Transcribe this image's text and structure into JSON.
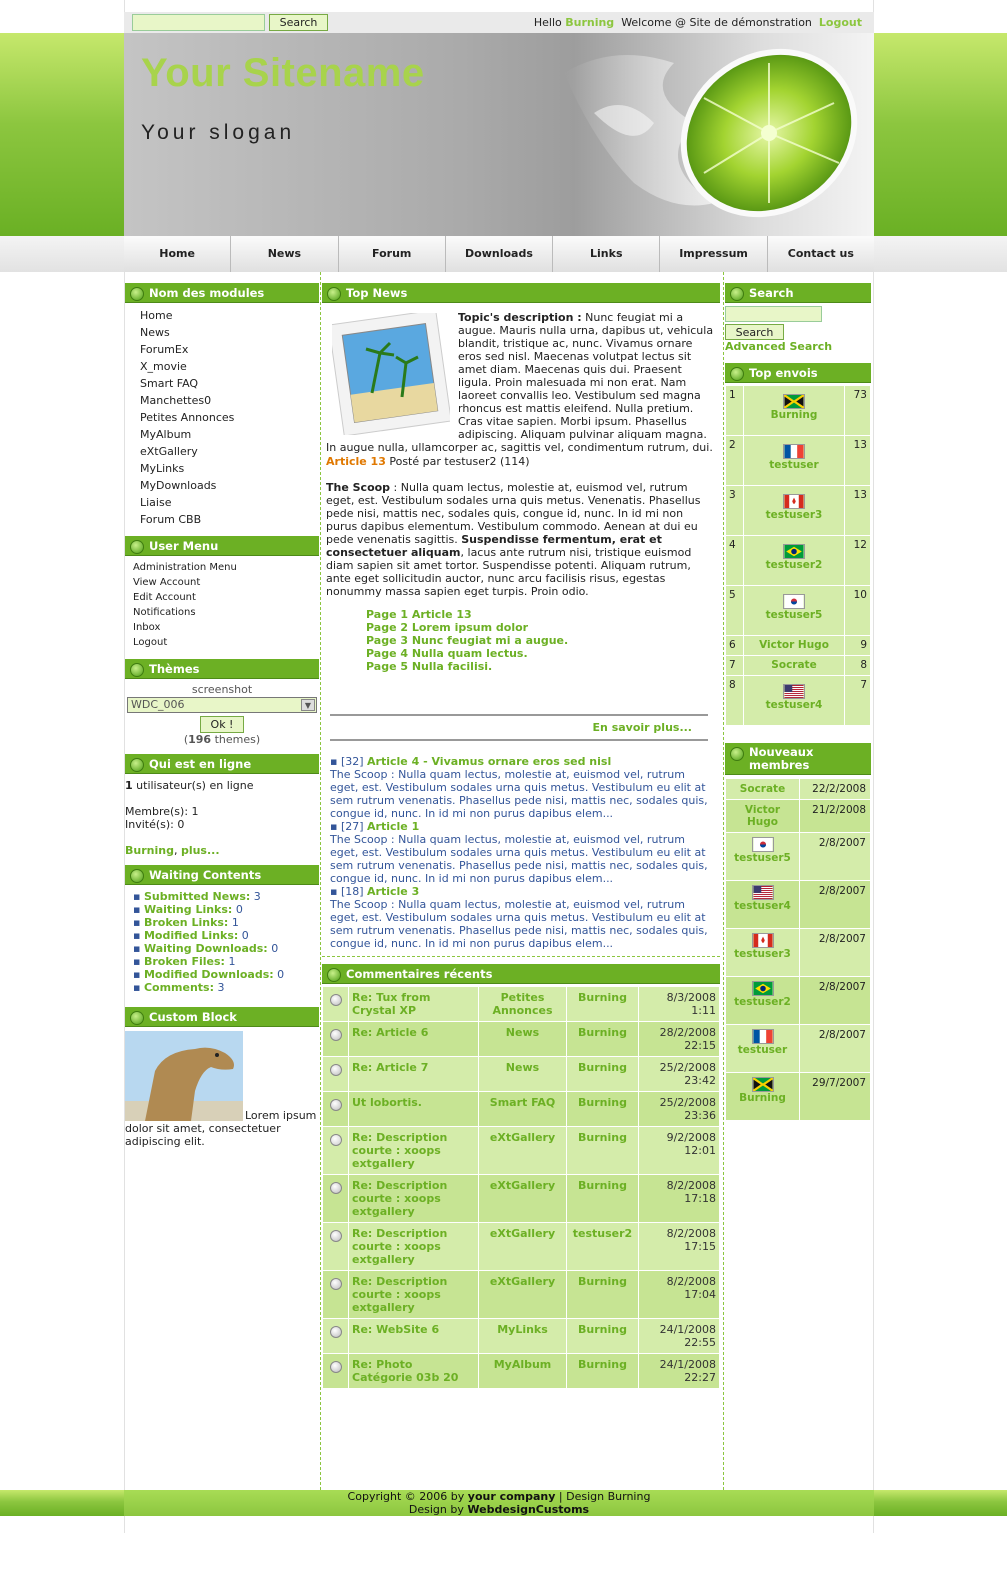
{
  "topbar": {
    "search_placeholder": "",
    "search_button": "Search",
    "hello": "Hello",
    "user": "Burning",
    "welcome": "Welcome @ Site de démonstration",
    "logout": "Logout"
  },
  "header": {
    "sitename": "Your Sitename",
    "slogan": "Your slogan"
  },
  "nav": [
    "Home",
    "News",
    "Forum",
    "Downloads",
    "Links",
    "Impressum",
    "Contact us"
  ],
  "modules": {
    "title": "Nom des modules",
    "items": [
      "Home",
      "News",
      "ForumEx",
      "X_movie",
      "Smart FAQ",
      "Manchettes0",
      "Petites Annonces",
      "MyAlbum",
      "eXtGallery",
      "MyLinks",
      "MyDownloads",
      "Liaise",
      "Forum CBB"
    ]
  },
  "usermenu": {
    "title": "User Menu",
    "items": [
      "Administration Menu",
      "View Account",
      "Edit Account",
      "Notifications",
      "Inbox",
      "Logout"
    ]
  },
  "themes": {
    "title": "Thèmes",
    "caption": "screenshot",
    "selected": "WDC_006",
    "ok": "Ok !",
    "count_pre": "(",
    "count": "196",
    "count_post": " themes)"
  },
  "online": {
    "title": "Qui est en ligne",
    "count": "1",
    "line1": " utilisateur(s) en ligne",
    "members": "Membre(s): 1",
    "guests": "Invité(s): 0",
    "user": "Burning",
    "more": "plus..."
  },
  "waiting": {
    "title": "Waiting Contents",
    "items": [
      {
        "label": "Submitted News:",
        "val": "3"
      },
      {
        "label": "Waiting Links:",
        "val": "0"
      },
      {
        "label": "Broken Links:",
        "val": "1"
      },
      {
        "label": "Modified Links:",
        "val": "0"
      },
      {
        "label": "Waiting Downloads:",
        "val": "0"
      },
      {
        "label": "Broken Files:",
        "val": "1"
      },
      {
        "label": "Modified Downloads:",
        "val": "0"
      },
      {
        "label": "Comments:",
        "val": "3"
      }
    ]
  },
  "custom": {
    "title": "Custom Block",
    "text": "Lorem ipsum dolor sit amet, consectetuer adipiscing elit."
  },
  "topnews": {
    "title": "Top News",
    "desc_label": "Topic's description :",
    "desc": " Nunc feugiat mi a augue. Mauris nulla urna, dapibus ut, vehicula blandit, tristique ac, nunc. Vivamus ornare eros sed nisl. Maecenas volutpat lectus sit amet diam. Maecenas quis dui. Praesent ligula. Proin malesuada mi non erat. Nam laoreet convallis leo. Vestibulum sed magna rhoncus est mattis eleifend. Nulla pretium. Cras vitae sapien. Morbi ipsum. Phasellus adipiscing. Aliquam pulvinar aliquam magna. In augue nulla, ullamcorper ac, sagittis vel, condimentum rutrum, dui.",
    "article": "Article 13",
    "posted": " Posté par testuser2 (114)",
    "scoop_label": "The Scoop",
    "scoop1": " : Nulla quam lectus, molestie at, euismod vel, rutrum eget, est. Vestibulum sodales urna quis metus. Venenatis. Phasellus pede nisi, mattis nec, sodales quis, congue id, nunc. In id mi non purus dapibus elementum. Vestibulum commodo. Aenean at dui eu pede venenatis sagittis. ",
    "scoop_bold": "Suspendisse fermentum, erat et consectetuer aliquam",
    "scoop2": ", lacus ante rutrum nisi, tristique euismod diam sapien sit amet tortor. Suspendisse potenti. Aliquam rutrum, ante eget sollicitudin auctor, nunc arcu facilisis risus, egestas nonummy massa sapien eget turpis. Proin odio.",
    "pages": [
      "Page 1 Article 13",
      "Page 2 Lorem ipsum dolor",
      "Page 3 Nunc feugiat mi a augue.",
      "Page 4 Nulla quam lectus.",
      "Page 5 Nulla facilisi."
    ],
    "more": "En savoir plus...",
    "list": [
      {
        "count": "[32]",
        "title": "Article 4 - Vivamus ornare eros sed nisl",
        "text": "The Scoop : Nulla quam lectus, molestie at, euismod vel, rutrum eget, est. Vestibulum sodales urna quis metus. Vestibulum eu elit at sem rutrum venenatis. Phasellus pede nisi, mattis nec, sodales quis, congue id, nunc. In id mi non purus dapibus elem..."
      },
      {
        "count": "[27]",
        "title": "Article 1",
        "text": "The Scoop : Nulla quam lectus, molestie at, euismod vel, rutrum eget, est. Vestibulum sodales urna quis metus. Vestibulum eu elit at sem rutrum venenatis. Phasellus pede nisi, mattis nec, sodales quis, congue id, nunc. In id mi non purus dapibus elem..."
      },
      {
        "count": "[18]",
        "title": "Article 3",
        "text": "The Scoop : Nulla quam lectus, molestie at, euismod vel, rutrum eget, est. Vestibulum sodales urna quis metus. Vestibulum eu elit at sem rutrum venenatis. Phasellus pede nisi, mattis nec, sodales quis, congue id, nunc. In id mi non purus dapibus elem..."
      }
    ]
  },
  "comments": {
    "title": "Commentaires récents",
    "rows": [
      {
        "title": "Re: Tux from Crystal XP",
        "module": "Petites Annonces",
        "user": "Burning",
        "date": "8/3/2008",
        "time": "1:11",
        "icon": "circle"
      },
      {
        "title": "Re: Article 6",
        "module": "News",
        "user": "Burning",
        "date": "28/2/2008",
        "time": "22:15",
        "icon": "circle"
      },
      {
        "title": "Re: Article 7",
        "module": "News",
        "user": "Burning",
        "date": "25/2/2008",
        "time": "23:42",
        "icon": "circle"
      },
      {
        "title": "Ut lobortis.",
        "module": "Smart FAQ",
        "user": "Burning",
        "date": "25/2/2008",
        "time": "23:36",
        "icon": "circle"
      },
      {
        "title": "Re: Description courte : xoops extgallery",
        "module": "eXtGallery",
        "user": "Burning",
        "date": "9/2/2008",
        "time": "12:01",
        "icon": "smiley"
      },
      {
        "title": "Re: Description courte : xoops extgallery",
        "module": "eXtGallery",
        "user": "Burning",
        "date": "8/2/2008",
        "time": "17:18",
        "icon": "circle"
      },
      {
        "title": "Re: Description courte : xoops extgallery",
        "module": "eXtGallery",
        "user": "testuser2",
        "date": "8/2/2008",
        "time": "17:15",
        "icon": "circle"
      },
      {
        "title": "Re: Description courte : xoops extgallery",
        "module": "eXtGallery",
        "user": "Burning",
        "date": "8/2/2008",
        "time": "17:04",
        "icon": "circle"
      },
      {
        "title": "Re: WebSite 6",
        "module": "MyLinks",
        "user": "Burning",
        "date": "24/1/2008",
        "time": "22:55",
        "icon": "circle"
      },
      {
        "title": "Re: Photo Catégorie 03b 20",
        "module": "MyAlbum",
        "user": "Burning",
        "date": "24/1/2008",
        "time": "22:27",
        "icon": "circle"
      }
    ]
  },
  "search": {
    "title": "Search",
    "button": "Search",
    "advanced": "Advanced Search"
  },
  "topenvois": {
    "title": "Top envois",
    "rows": [
      {
        "rank": "1",
        "name": "Burning",
        "count": "73",
        "flag": "jamaica"
      },
      {
        "rank": "2",
        "name": "testuser",
        "count": "13",
        "flag": "france"
      },
      {
        "rank": "3",
        "name": "testuser3",
        "count": "13",
        "flag": "canada"
      },
      {
        "rank": "4",
        "name": "testuser2",
        "count": "12",
        "flag": "brazil"
      },
      {
        "rank": "5",
        "name": "testuser5",
        "count": "10",
        "flag": "korea"
      },
      {
        "rank": "6",
        "name": "Victor Hugo",
        "count": "9",
        "flag": ""
      },
      {
        "rank": "7",
        "name": "Socrate",
        "count": "8",
        "flag": ""
      },
      {
        "rank": "8",
        "name": "testuser4",
        "count": "7",
        "flag": "usa"
      }
    ]
  },
  "newmembers": {
    "title": "Nouveaux membres",
    "rows": [
      {
        "name": "Socrate",
        "date": "22/2/2008",
        "flag": ""
      },
      {
        "name": "Victor Hugo",
        "date": "21/2/2008",
        "flag": ""
      },
      {
        "name": "testuser5",
        "date": "2/8/2007",
        "flag": "korea"
      },
      {
        "name": "testuser4",
        "date": "2/8/2007",
        "flag": "usa"
      },
      {
        "name": "testuser3",
        "date": "2/8/2007",
        "flag": "canada"
      },
      {
        "name": "testuser2",
        "date": "2/8/2007",
        "flag": "brazil"
      },
      {
        "name": "testuser",
        "date": "2/8/2007",
        "flag": "france"
      },
      {
        "name": "Burning",
        "date": "29/7/2007",
        "flag": "jamaica"
      }
    ]
  },
  "footer": {
    "l1a": "Copyright © 2006 by ",
    "l1b": "your company",
    "l1c": "  |  Design Burning",
    "l2a": "Design by ",
    "l2b": "WebdesignCustoms"
  },
  "colors": {
    "accent": "#6cb024",
    "link": "#8cc63f",
    "header_gray": "#aaaaaa"
  }
}
